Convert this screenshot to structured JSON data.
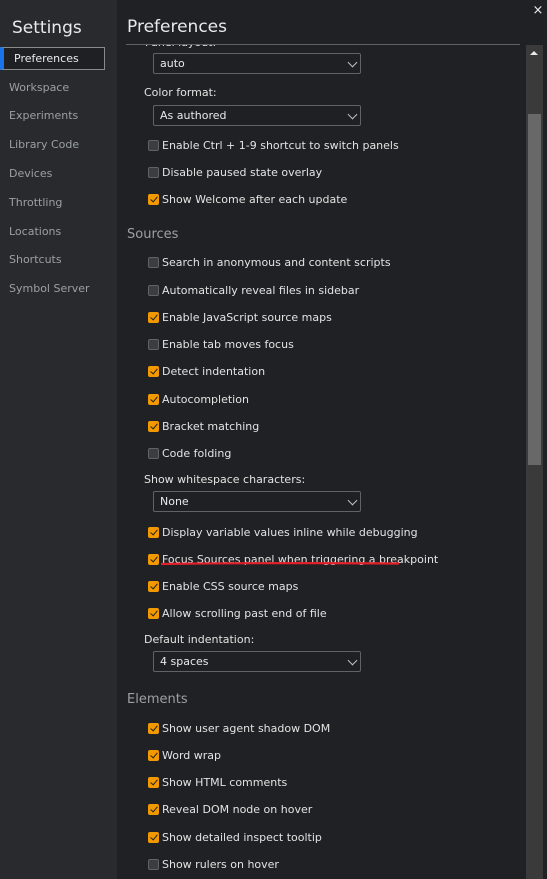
{
  "sidebar": {
    "title": "Settings",
    "items": [
      {
        "label": "Preferences",
        "selected": true
      },
      {
        "label": "Workspace"
      },
      {
        "label": "Experiments"
      },
      {
        "label": "Library Code"
      },
      {
        "label": "Devices"
      },
      {
        "label": "Throttling"
      },
      {
        "label": "Locations"
      },
      {
        "label": "Shortcuts"
      },
      {
        "label": "Symbol Server"
      }
    ]
  },
  "header": {
    "title": "Preferences",
    "close_icon": "×"
  },
  "appearance": {
    "cut_label": "Panel layout:",
    "panel_layout_value": "auto",
    "color_format_label": "Color format:",
    "color_format_value": "As authored",
    "checkboxes": [
      {
        "label": "Enable Ctrl + 1-9 shortcut to switch panels",
        "checked": false
      },
      {
        "label": "Disable paused state overlay",
        "checked": false
      },
      {
        "label": "Show Welcome after each update",
        "checked": true
      }
    ]
  },
  "sources": {
    "title": "Sources",
    "checkboxes": [
      {
        "label": "Search in anonymous and content scripts",
        "checked": false
      },
      {
        "label": "Automatically reveal files in sidebar",
        "checked": false
      },
      {
        "label": "Enable JavaScript source maps",
        "checked": true
      },
      {
        "label": "Enable tab moves focus",
        "checked": false
      },
      {
        "label": "Detect indentation",
        "checked": true
      },
      {
        "label": "Autocompletion",
        "checked": true
      },
      {
        "label": "Bracket matching",
        "checked": true
      },
      {
        "label": "Code folding",
        "checked": false
      }
    ],
    "whitespace_label": "Show whitespace characters:",
    "whitespace_value": "None",
    "checkboxes2": [
      {
        "label": "Display variable values inline while debugging",
        "checked": true
      },
      {
        "label": "Focus Sources panel when triggering a breakpoint",
        "checked": true
      },
      {
        "label": "Enable CSS source maps",
        "checked": true
      },
      {
        "label": "Allow scrolling past end of file",
        "checked": true
      }
    ],
    "indent_label": "Default indentation:",
    "indent_value": "4 spaces"
  },
  "elements": {
    "title": "Elements",
    "checkboxes": [
      {
        "label": "Show user agent shadow DOM",
        "checked": true
      },
      {
        "label": "Word wrap",
        "checked": true
      },
      {
        "label": "Show HTML comments",
        "checked": true
      },
      {
        "label": "Reveal DOM node on hover",
        "checked": true
      },
      {
        "label": "Show detailed inspect tooltip",
        "checked": true
      },
      {
        "label": "Show rulers on hover",
        "checked": false
      }
    ]
  },
  "colors": {
    "accent": "#f29900",
    "selection": "#1a73e8",
    "annotation": "#e0202a"
  }
}
